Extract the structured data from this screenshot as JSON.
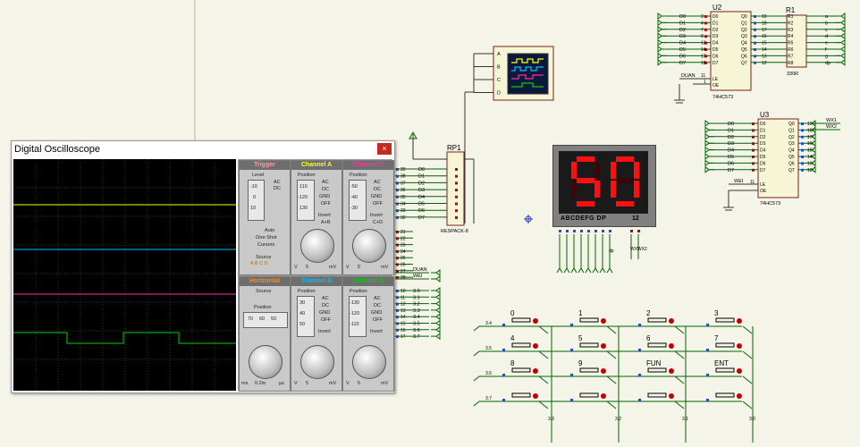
{
  "oscilloscope": {
    "title": "Digital Oscilloscope",
    "close_label": "×",
    "trigger": {
      "header": "Trigger",
      "level_label": "Level",
      "ac": "AC",
      "dc": "DC",
      "auto": "Auto",
      "one_shot": "One-Shot",
      "cursors": "Cursors",
      "source": "Source",
      "source_options": "A B C D"
    },
    "channel_a": {
      "header": "Channel A",
      "position_label": "Position",
      "ac": "AC",
      "dc": "DC",
      "gnd": "GND",
      "off": "OFF",
      "invert": "Invert",
      "mode": "A+B",
      "pos_value": "-120",
      "pos_hi": "110",
      "pos_lo": "130",
      "scale": "5",
      "unit": "mV",
      "v": "V"
    },
    "channel_b": {
      "header": "Channel B",
      "position_label": "Position",
      "ac": "AC",
      "dc": "DC",
      "gnd": "GND",
      "off": "OFF",
      "invert": "Invert",
      "pos_value": "40",
      "pos_hi": "30",
      "pos_lo": "50",
      "scale": "5",
      "unit": "mV",
      "v": "V"
    },
    "channel_c": {
      "header": "Channel C",
      "position_label": "Position",
      "ac": "AC",
      "dc": "DC",
      "gnd": "GND",
      "off": "OFF",
      "invert": "Invert",
      "mode": "C+D",
      "pos_value": "-40",
      "pos_hi": "-50",
      "pos_lo": "-30",
      "scale": "5",
      "unit": "mV",
      "v": "V"
    },
    "channel_d": {
      "header": "Channel D",
      "position_label": "Position",
      "ac": "AC",
      "dc": "DC",
      "gnd": "GND",
      "off": "OFF",
      "invert": "Invert",
      "pos_value": "-120",
      "pos_hi": "-130",
      "pos_lo": "-110",
      "scale": "5",
      "unit": "mV",
      "v": "V"
    },
    "horizontal": {
      "header": "Horizontal",
      "source": "Source",
      "position_label": "Position",
      "pos_lo": "70",
      "pos_value": "60",
      "pos_hi": "50",
      "scale": "0.2m",
      "unit": "ms",
      "unit2": "µs"
    },
    "trigger_level": {
      "value": "0",
      "hi": "-10",
      "lo": "10"
    }
  },
  "schematic": {
    "u2": {
      "name": "U2",
      "type": "74HC573",
      "inputs": [
        "D0",
        "D1",
        "D2",
        "D3",
        "D4",
        "D5",
        "D6",
        "D7"
      ],
      "outputs": [
        "Q0",
        "Q1",
        "Q2",
        "Q3",
        "Q4",
        "Q5",
        "Q6",
        "Q7"
      ],
      "le": "LE",
      "oe": "OE",
      "net_duan": "DUAN",
      "pins_in": [
        "3",
        "4",
        "7",
        "8",
        "13",
        "14",
        "17",
        "18"
      ],
      "pins_out": [
        "19",
        "18",
        "17",
        "16",
        "15",
        "14",
        "13",
        "12"
      ],
      "pin_le": "11",
      "pin_oe": "1"
    },
    "u3": {
      "name": "U3",
      "type": "74HC573",
      "inputs": [
        "D0",
        "D1",
        "D2",
        "D3",
        "D4",
        "D5",
        "D6",
        "D7"
      ],
      "outputs": [
        "Q0",
        "Q1",
        "Q2",
        "Q3",
        "Q4",
        "Q5",
        "Q6",
        "Q7"
      ],
      "le": "LE",
      "oe": "OE",
      "net_wei": "WEI",
      "pins_out": [
        "19",
        "18",
        "17",
        "16",
        "15",
        "14",
        "13",
        "12"
      ],
      "pin_le": "11",
      "pin_oe": "1",
      "net_wx1": "WX1",
      "net_wx2": "WX2"
    },
    "r1": {
      "name": "R1",
      "value": "330R",
      "nets": [
        "a",
        "b",
        "c",
        "d",
        "e",
        "f",
        "g",
        "dp"
      ],
      "pin_names": [
        "R1",
        "R2",
        "R3",
        "R4",
        "R5",
        "R6",
        "R7",
        "R8"
      ]
    },
    "rp1": {
      "name": "RP1",
      "type": "RESPACK-8",
      "nets": [
        "D0",
        "D1",
        "D2",
        "D3",
        "D4",
        "D5",
        "D6",
        "D7"
      ],
      "pins": [
        "39",
        "38",
        "37",
        "36",
        "35",
        "34",
        "33",
        "32"
      ]
    },
    "port2": {
      "pins": [
        "21",
        "22",
        "23",
        "24",
        "25",
        "26",
        "27",
        "28"
      ],
      "nets": [
        "DUAN",
        "WEI"
      ]
    },
    "port3": {
      "pins": [
        "10",
        "11",
        "12",
        "13",
        "14",
        "15",
        "16",
        "17"
      ],
      "nets": [
        "3.0",
        "3.1",
        "3.2",
        "3.3",
        "3.4",
        "3.5",
        "3.6",
        "3.7"
      ]
    },
    "scope_probe": {
      "inputs": [
        "A",
        "B",
        "C",
        "D"
      ]
    },
    "display": {
      "digits": "50",
      "segments_label": "ABCDEFG DP",
      "select_label": "12",
      "wx1": "WX1",
      "wx2": "WX2"
    },
    "keypad": {
      "keys": [
        "0",
        "1",
        "2",
        "3",
        "4",
        "5",
        "6",
        "7",
        "8",
        "9",
        "FUN",
        "ENT",
        "",
        "",
        "",
        ""
      ],
      "row_nets": [
        "3.4",
        "3.5",
        "3.6",
        "3.7"
      ],
      "col_nets": [
        "3.3",
        "3.2",
        "3.1",
        "3.0"
      ]
    }
  },
  "colors": {
    "background": "#f4f4e8",
    "wire": "#000000",
    "wire_green": "#006400",
    "ch_a": "#ffff00",
    "ch_b": "#00bfff",
    "ch_c": "#ff2fa2",
    "ch_d": "#00d400",
    "seg_on": "#ff1010",
    "pin_red": "#c00000",
    "pin_blue": "#1a4fd8"
  }
}
